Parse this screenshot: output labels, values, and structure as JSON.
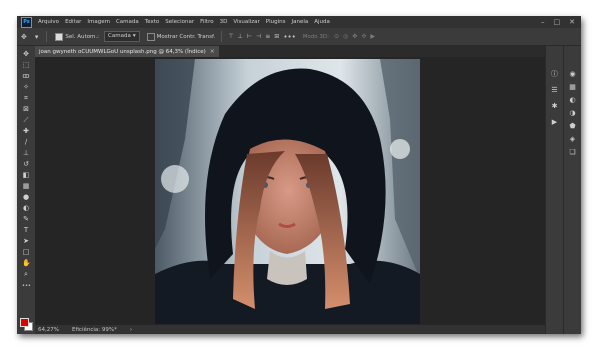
{
  "app": {
    "logo": "Ps"
  },
  "menubar": {
    "items": [
      "Arquivo",
      "Editar",
      "Imagem",
      "Camada",
      "Texto",
      "Selecionar",
      "Filtro",
      "3D",
      "Visualizar",
      "Plugins",
      "Janela",
      "Ajuda"
    ]
  },
  "window_controls": {
    "minimize": "–",
    "maximize": "□",
    "close": "✕"
  },
  "options": {
    "move_icon": "✥",
    "auto_select_label": "Sel. Autom.:",
    "auto_select_target": "Camada",
    "auto_select_checked": true,
    "show_transform_label": "Mostrar Contr. Transf.",
    "show_transform_checked": false,
    "align_icons": [
      "⊤",
      "⊥",
      "⊢",
      "⊣",
      "≡",
      "⊞"
    ],
    "more": "•••",
    "mode_3d_label": "Modo 3D:",
    "mode_3d_icons": [
      "⊙",
      "◎",
      "✥",
      "✣",
      "▶"
    ]
  },
  "document": {
    "tab_title": "joan gwyneth oCUUMWLGoU unsplash.png @ 64,3% (Índice)",
    "close": "×"
  },
  "tools": [
    {
      "name": "move-tool",
      "glyph": "✥"
    },
    {
      "name": "marquee-tool",
      "glyph": "⬚"
    },
    {
      "name": "lasso-tool",
      "glyph": "ꝏ"
    },
    {
      "name": "magic-wand-tool",
      "glyph": "✧"
    },
    {
      "name": "crop-tool",
      "glyph": "⌗"
    },
    {
      "name": "frame-tool",
      "glyph": "⊠"
    },
    {
      "name": "eyedropper-tool",
      "glyph": "⟋"
    },
    {
      "name": "healing-brush-tool",
      "glyph": "✚"
    },
    {
      "name": "brush-tool",
      "glyph": "∕"
    },
    {
      "name": "clone-stamp-tool",
      "glyph": "⊥"
    },
    {
      "name": "history-brush-tool",
      "glyph": "↺"
    },
    {
      "name": "eraser-tool",
      "glyph": "◧"
    },
    {
      "name": "gradient-tool",
      "glyph": "▦"
    },
    {
      "name": "blur-tool",
      "glyph": "●"
    },
    {
      "name": "dodge-tool",
      "glyph": "◐"
    },
    {
      "name": "pen-tool",
      "glyph": "✎"
    },
    {
      "name": "type-tool",
      "glyph": "T"
    },
    {
      "name": "path-selection-tool",
      "glyph": "➤"
    },
    {
      "name": "rectangle-tool",
      "glyph": "□"
    },
    {
      "name": "hand-tool",
      "glyph": "✋"
    },
    {
      "name": "zoom-tool",
      "glyph": "⌕"
    },
    {
      "name": "more-tools",
      "glyph": "•••"
    }
  ],
  "colors": {
    "foreground": "#e00000",
    "background": "#ffffff",
    "app_bg": "#535353",
    "panel_bg": "#3b3b3b",
    "canvas_bg": "#252525"
  },
  "status": {
    "zoom": "64,27%",
    "efficiency": "Eficiência: 99%*",
    "arrow": "›"
  },
  "right_panels": {
    "strip1": [
      "ⓘ",
      "☰",
      "✱",
      "▶"
    ],
    "strip2": [
      "◉",
      "▦",
      "◐",
      "◑",
      "⬟",
      "◈",
      "❏"
    ]
  }
}
